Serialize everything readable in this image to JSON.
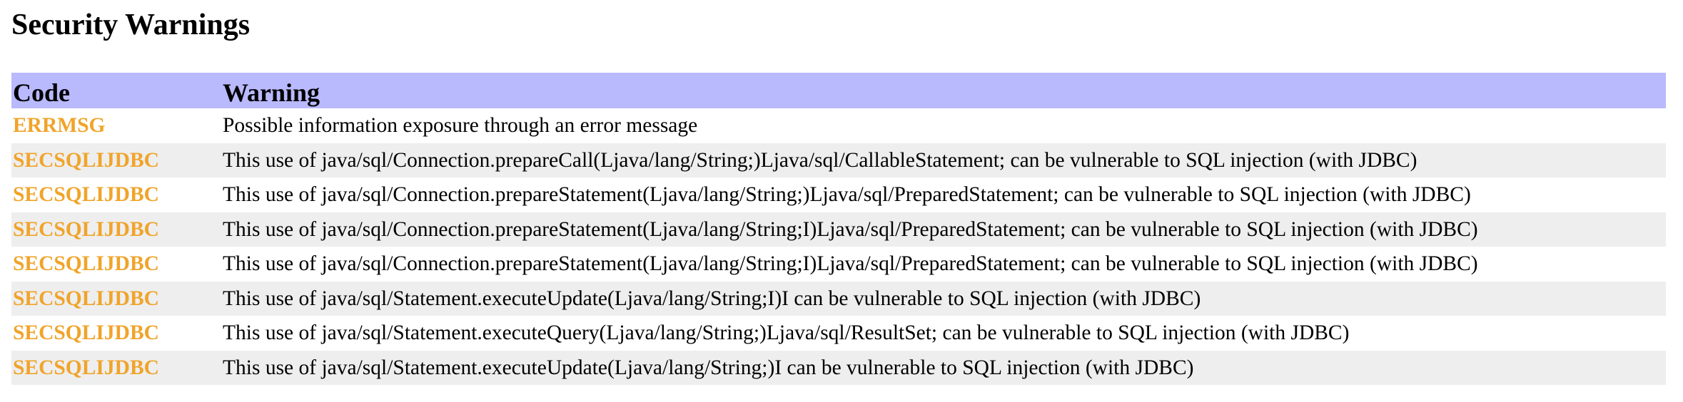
{
  "page": {
    "title": "Security Warnings"
  },
  "colors": {
    "header_bg": "#b9b9fe",
    "row_even_bg": "#eeeeee",
    "row_odd_bg": "#ffffff",
    "code_text": "#f0a42a",
    "text": "#000000"
  },
  "table": {
    "headers": {
      "code": "Code",
      "warning": "Warning"
    },
    "rows": [
      {
        "code": "ERRMSG",
        "warning": "Possible information exposure through an error message"
      },
      {
        "code": "SECSQLIJDBC",
        "warning": "This use of java/sql/Connection.prepareCall(Ljava/lang/String;)Ljava/sql/CallableStatement; can be vulnerable to SQL injection (with JDBC)"
      },
      {
        "code": "SECSQLIJDBC",
        "warning": "This use of java/sql/Connection.prepareStatement(Ljava/lang/String;)Ljava/sql/PreparedStatement; can be vulnerable to SQL injection (with JDBC)"
      },
      {
        "code": "SECSQLIJDBC",
        "warning": "This use of java/sql/Connection.prepareStatement(Ljava/lang/String;I)Ljava/sql/PreparedStatement; can be vulnerable to SQL injection (with JDBC)"
      },
      {
        "code": "SECSQLIJDBC",
        "warning": "This use of java/sql/Connection.prepareStatement(Ljava/lang/String;I)Ljava/sql/PreparedStatement; can be vulnerable to SQL injection (with JDBC)"
      },
      {
        "code": "SECSQLIJDBC",
        "warning": "This use of java/sql/Statement.executeUpdate(Ljava/lang/String;I)I can be vulnerable to SQL injection (with JDBC)"
      },
      {
        "code": "SECSQLIJDBC",
        "warning": "This use of java/sql/Statement.executeQuery(Ljava/lang/String;)Ljava/sql/ResultSet; can be vulnerable to SQL injection (with JDBC)"
      },
      {
        "code": "SECSQLIJDBC",
        "warning": "This use of java/sql/Statement.executeUpdate(Ljava/lang/String;)I can be vulnerable to SQL injection (with JDBC)"
      }
    ]
  }
}
